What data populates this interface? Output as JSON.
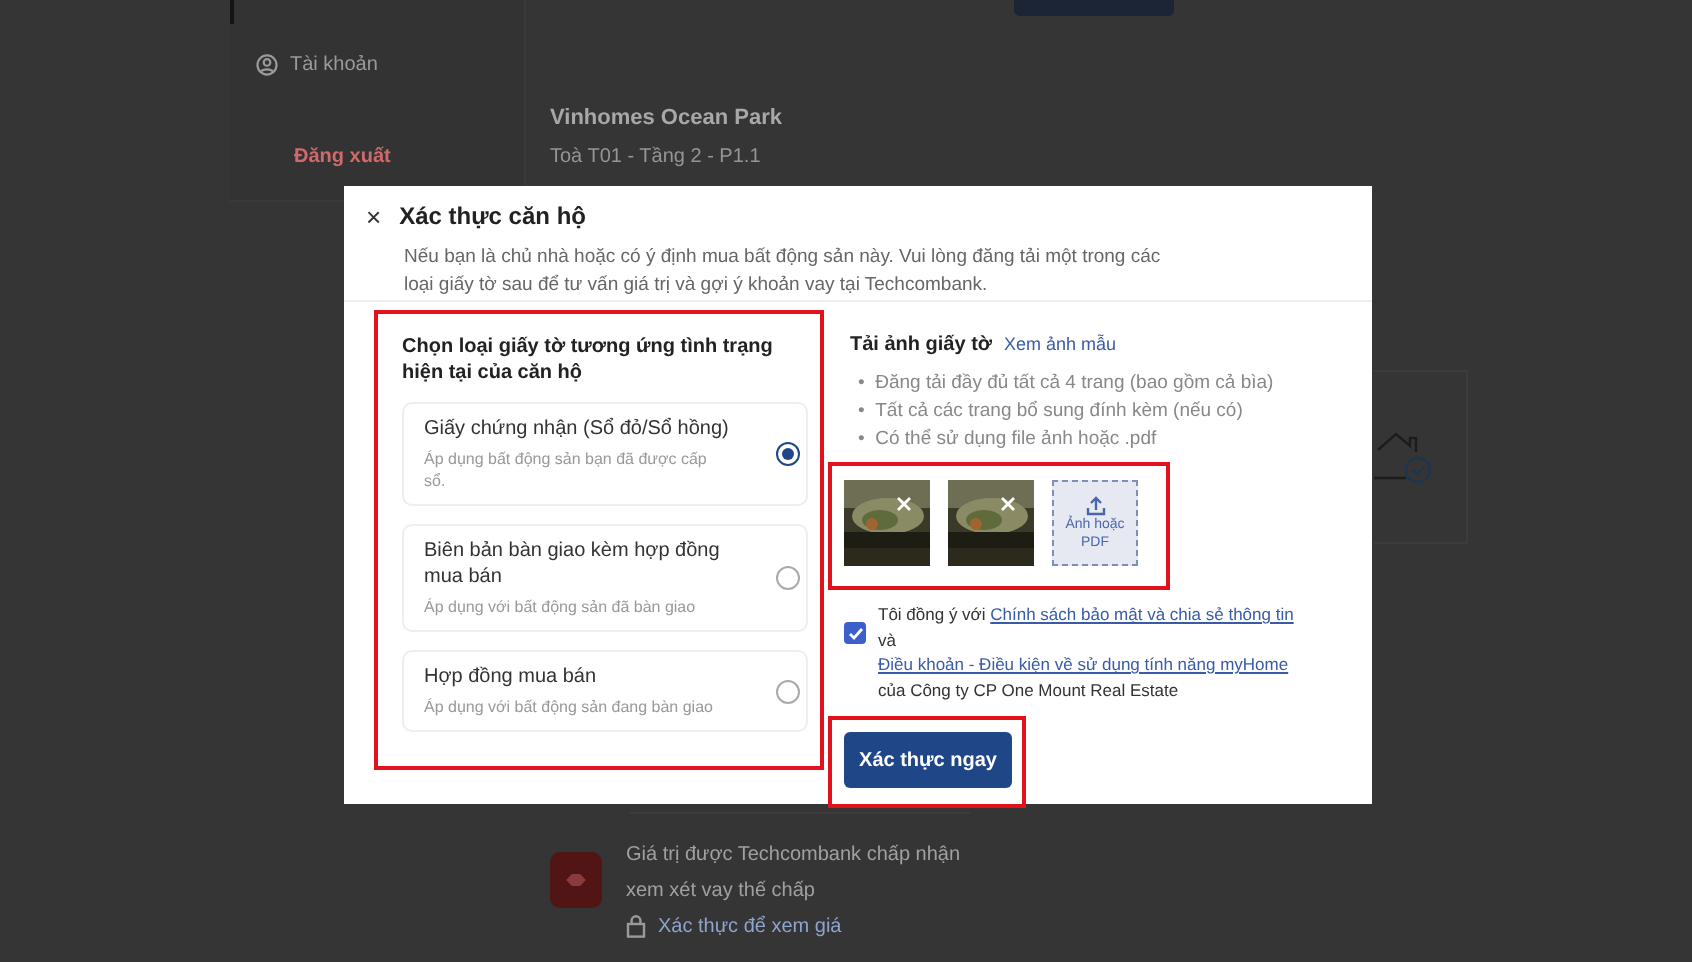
{
  "background": {
    "sidebar": {
      "items": [
        {
          "label": "Tài khoản",
          "kind": "account"
        },
        {
          "label": "Đăng xuất",
          "kind": "logout"
        }
      ]
    },
    "property": {
      "name": "Vinhomes Ocean Park",
      "unit": "Toà T01 - Tầng 2 - P1.1"
    },
    "valuation": {
      "text": "Giá trị được Techcombank chấp nhận xem xét vay thế chấp",
      "lock_link": "Xác thực để xem giá"
    }
  },
  "modal": {
    "close": "×",
    "title": "Xác thực căn hộ",
    "description": "Nếu bạn là chủ nhà hoặc có ý định mua bất động sản này. Vui lòng đăng tải một trong các loại giấy tờ sau để tư vấn giá trị và gợi ý khoản vay tại Techcombank.",
    "document_type": {
      "heading": "Chọn loại giấy tờ tương ứng tình trạng hiện tại của căn hộ",
      "options": [
        {
          "title": "Giấy chứng nhận (Sổ đỏ/Sổ hồng)",
          "subtitle": "Áp dụng bất động sản bạn đã được cấp sổ.",
          "selected": true
        },
        {
          "title": "Biên bản bàn giao kèm hợp đồng mua bán",
          "subtitle": "Áp dụng với bất động sản đã bàn giao",
          "selected": false
        },
        {
          "title": "Hợp đồng mua bán",
          "subtitle": "Áp dụng với bất động sản đang bàn giao",
          "selected": false
        }
      ]
    },
    "upload": {
      "heading": "Tải ảnh giấy tờ",
      "sample_link": "Xem ảnh mẫu",
      "bullet": "•",
      "tips": [
        "Đăng tải đầy đủ tất cả 4 trang (bao gồm cả bìa)",
        "Tất cả các trang bổ sung đính kèm (nếu có)",
        "Có thể sử dụng file ảnh hoặc .pdf"
      ],
      "add_label": "Ảnh hoặc PDF"
    },
    "consent": {
      "checked": true,
      "parts": [
        {
          "kind": "text",
          "text": "Tôi đồng ý với "
        },
        {
          "kind": "link",
          "text": "Chính sách bảo mật và chia sẻ thông tin"
        },
        {
          "kind": "text",
          "text": " và "
        },
        {
          "kind": "link",
          "text": "Điều khoản - Điều kiện về sử dụng tính năng myHome"
        },
        {
          "kind": "text",
          "text": " của Công ty CP One Mount Real Estate"
        }
      ]
    },
    "submit": "Xác thực ngay"
  }
}
